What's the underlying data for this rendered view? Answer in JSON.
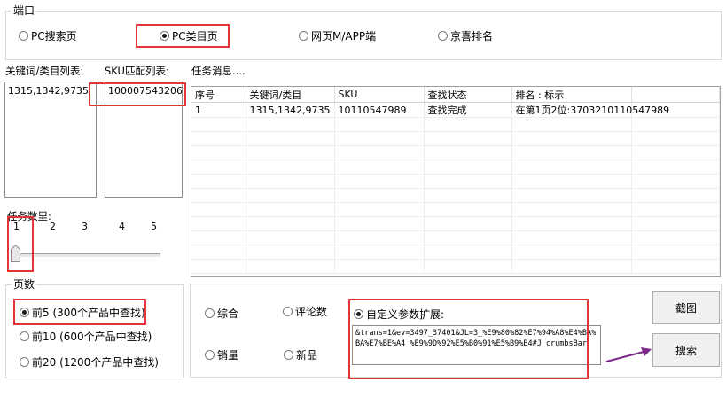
{
  "port_group": {
    "legend": "端口",
    "options": [
      {
        "label": "PC搜索页",
        "selected": false
      },
      {
        "label": "PC类目页",
        "selected": true
      },
      {
        "label": "网页M/APP端",
        "selected": false
      },
      {
        "label": "京喜排名",
        "selected": false
      }
    ]
  },
  "keyword_list": {
    "label": "关键词/类目列表:",
    "value": "1315,1342,9735"
  },
  "sku_list": {
    "label": "SKU匹配列表:",
    "value": "100007543206"
  },
  "task_message": {
    "label": "任务消息...."
  },
  "result_table": {
    "columns": [
      "序号",
      "关键词/类目",
      "SKU",
      "查找状态",
      "排名 : 标示"
    ],
    "rows": [
      [
        "1",
        "1315,1342,9735",
        "10110547989",
        "查找完成",
        "在第1页2位:3703210110547989"
      ]
    ]
  },
  "task_count": {
    "label": "任务数里:",
    "ticks": [
      "1",
      "2",
      "3",
      "4",
      "5"
    ],
    "value": 1
  },
  "pages_group": {
    "legend": "页数",
    "options": [
      {
        "label": "前5 (300个产品中查找)",
        "selected": true
      },
      {
        "label": "前10 (600个产品中查找)",
        "selected": false
      },
      {
        "label": "前20 (1200个产品中查找)",
        "selected": false
      }
    ]
  },
  "sort_group": {
    "options": [
      {
        "label": "综合",
        "selected": false
      },
      {
        "label": "评论数",
        "selected": false
      },
      {
        "label": "销量",
        "selected": false
      },
      {
        "label": "新品",
        "selected": false
      },
      {
        "label": "自定义参数扩展:",
        "selected": true
      }
    ],
    "custom_param": "&trans=1&ev=3497_37401&JL=3_%E9%80%82%E7%94%A8%E4%BA%BA%E7%BE%A4_%E9%9D%92%E5%B0%91%E5%B9%B4#J_crumbsBar"
  },
  "buttons": {
    "screenshot": "截图",
    "search": "搜索"
  },
  "colors": {
    "highlight": "#e23636",
    "arrow": "#7b2a8c"
  }
}
